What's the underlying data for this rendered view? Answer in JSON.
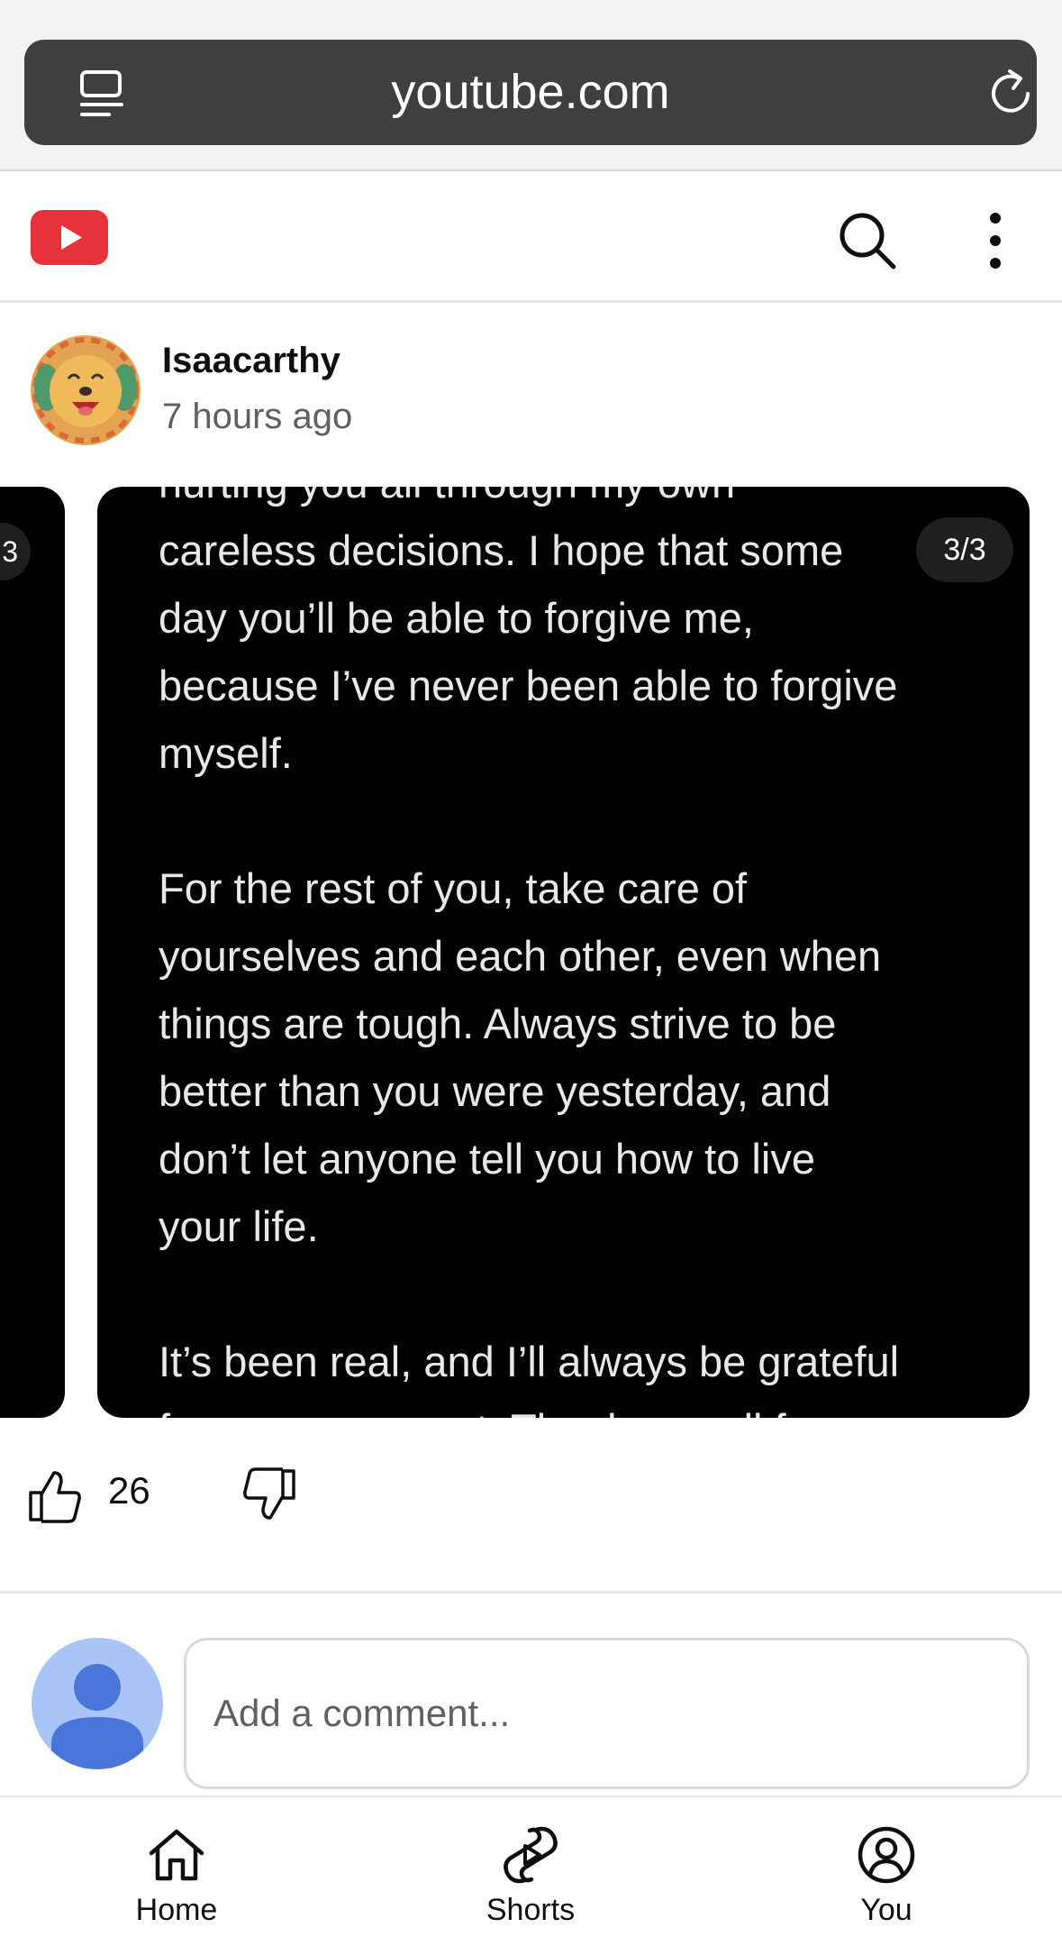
{
  "browser": {
    "url": "youtube.com"
  },
  "header": {
    "logo_icon": "youtube-logo",
    "search_icon": "search-icon",
    "more_icon": "more-vertical-icon",
    "brand_color": "#ff0000"
  },
  "post": {
    "channel_name": "Isaacarthy",
    "time_ago": "7 hours ago",
    "slide_counter": "3/3",
    "prev_slide_counter": "3",
    "slide_text": "hurting you all through my own\ncareless decisions. I hope that some\nday you’ll be able to forgive me,\nbecause I’ve never been able to forgive\nmyself.\n\nFor the rest of you, take care of\nyourselves and each other, even when\nthings are tough. Always strive to be\nbetter than you were yesterday, and\ndon’t let anyone tell you how to live\nyour life.\n\nIt’s been real, and I’ll always be grateful\nfor every moment. Thank you all for",
    "like_count": "26"
  },
  "comment": {
    "placeholder": "Add a comment..."
  },
  "nav": {
    "home": "Home",
    "shorts": "Shorts",
    "you": "You"
  }
}
